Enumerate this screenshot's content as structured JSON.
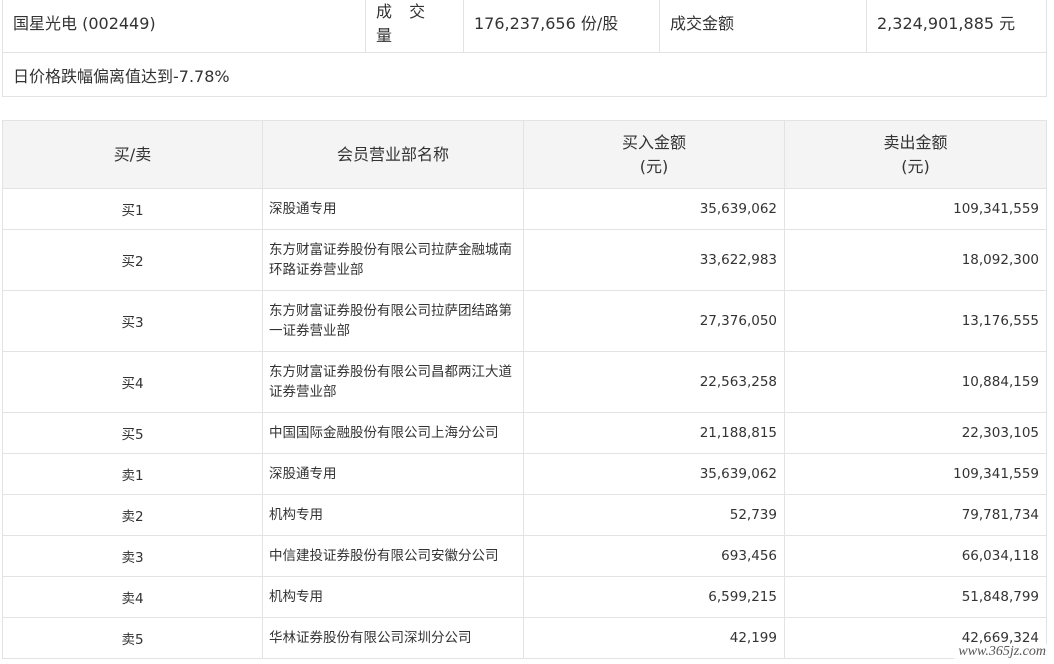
{
  "summary": {
    "stock": "国星光电 (002449)",
    "volume_label": "成 交 量",
    "volume_value": "176,237,656 份/股",
    "amount_label": "成交金额",
    "amount_value": "2,324,901,885 元",
    "note": "日价格跌幅偏离值达到-7.78%"
  },
  "table": {
    "headers": {
      "side": "买/卖",
      "member": "会员营业部名称",
      "buy_line1": "买入金额",
      "buy_line2": "(元)",
      "sell_line1": "卖出金额",
      "sell_line2": "(元)"
    },
    "rows": [
      {
        "side": "买1",
        "member": "深股通专用",
        "buy": "35,639,062",
        "sell": "109,341,559"
      },
      {
        "side": "买2",
        "member": "东方财富证券股份有限公司拉萨金融城南环路证券营业部",
        "buy": "33,622,983",
        "sell": "18,092,300"
      },
      {
        "side": "买3",
        "member": "东方财富证券股份有限公司拉萨团结路第一证券营业部",
        "buy": "27,376,050",
        "sell": "13,176,555"
      },
      {
        "side": "买4",
        "member": "东方财富证券股份有限公司昌都两江大道证券营业部",
        "buy": "22,563,258",
        "sell": "10,884,159"
      },
      {
        "side": "买5",
        "member": "中国国际金融股份有限公司上海分公司",
        "buy": "21,188,815",
        "sell": "22,303,105"
      },
      {
        "side": "卖1",
        "member": "深股通专用",
        "buy": "35,639,062",
        "sell": "109,341,559"
      },
      {
        "side": "卖2",
        "member": "机构专用",
        "buy": "52,739",
        "sell": "79,781,734"
      },
      {
        "side": "卖3",
        "member": "中信建投证券股份有限公司安徽分公司",
        "buy": "693,456",
        "sell": "66,034,118"
      },
      {
        "side": "卖4",
        "member": "机构专用",
        "buy": "6,599,215",
        "sell": "51,848,799"
      },
      {
        "side": "卖5",
        "member": "华林证券股份有限公司深圳分公司",
        "buy": "42,199",
        "sell": "42,669,324"
      }
    ]
  },
  "watermark": "www.365jz.com"
}
